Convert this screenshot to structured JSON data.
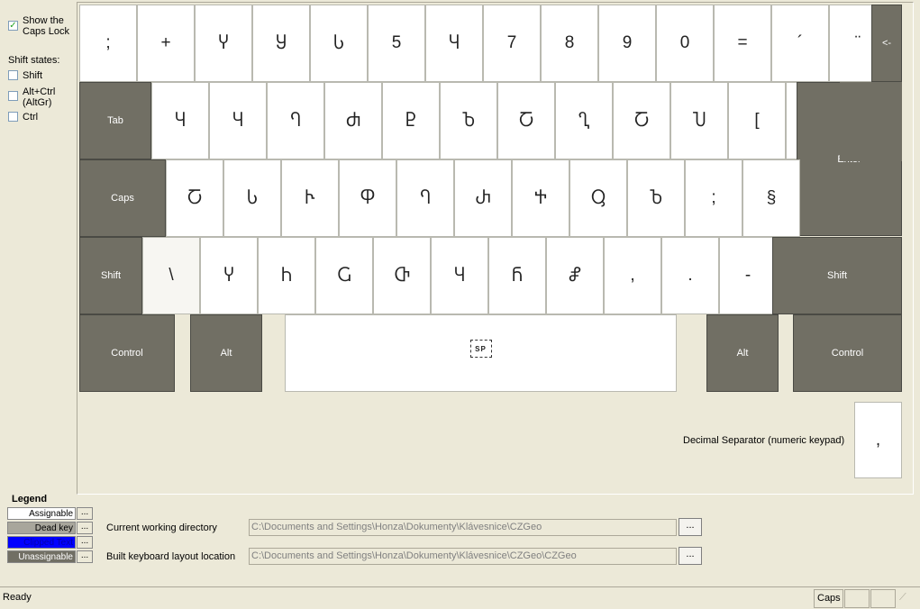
{
  "options": {
    "show_caps_lock_label": "Show the\nCaps Lock",
    "show_caps_lock_checked": true,
    "shift_states_title": "Shift states:",
    "shift_label": "Shift",
    "altgr_label": "Alt+Ctrl\n(AltGr)",
    "ctrl_label": "Ctrl"
  },
  "keyboard": {
    "row1": [
      ";",
      "+",
      "Ⴤ",
      "Ⴘ",
      "Ⴑ",
      "5",
      "Ⴗ",
      "7",
      "8",
      "9",
      "0",
      "=",
      "´",
      "¨"
    ],
    "backspace": "<-",
    "tab": "Tab",
    "row2": [
      "Ⴗ",
      "Ⴗ",
      "Ⴄ",
      "Ⴛ",
      "Ⴒ",
      "Ⴆ",
      "Ⴀ",
      "Ⴂ",
      "Ⴀ",
      "Ⴎ",
      "[",
      "("
    ],
    "caps": "Caps",
    "row3": [
      "Ⴀ",
      "Ⴑ",
      "Ⴡ",
      "Ⴔ",
      "Ⴄ",
      "Ⴐ",
      "Ⴕ",
      "Ⴓ",
      "Ⴆ",
      ";",
      "§"
    ],
    "enter": "Enter",
    "shift_left": "Shift",
    "row4": [
      "\\",
      "Ⴤ",
      "Ⴙ",
      "Ⴚ",
      "Ⴇ",
      "Ⴗ",
      "Ⴌ",
      "Ⴥ",
      ",",
      ".",
      "-"
    ],
    "shift_right": "Shift",
    "control_left": "Control",
    "alt_left": "Alt",
    "space_label": "SP",
    "alt_right": "Alt",
    "control_right": "Control",
    "decimal_sep_label": "Decimal Separator (numeric keypad)",
    "decimal_sep_key": ","
  },
  "legend": {
    "title": "Legend",
    "items": [
      {
        "label": "Assignable",
        "bg": "#ffffff",
        "fg": "#000000"
      },
      {
        "label": "Dead key",
        "bg": "#a8a69c",
        "fg": "#000000"
      },
      {
        "label": "Clipped Text",
        "bg": "#0000ff",
        "fg": "#0000aa"
      },
      {
        "label": "Unassignable",
        "bg": "#716f64",
        "fg": "#ffffff"
      }
    ],
    "dots": "..."
  },
  "paths": {
    "cwd_label": "Current working directory",
    "cwd_value": "C:\\Documents and Settings\\Honza\\Dokumenty\\Klávesnice\\CZGeo",
    "built_label": "Built keyboard layout location",
    "built_value": "C:\\Documents and Settings\\Honza\\Dokumenty\\Klávesnice\\CZGeo\\CZGeo",
    "browse": "..."
  },
  "status": {
    "ready": "Ready",
    "caps": "Caps"
  }
}
